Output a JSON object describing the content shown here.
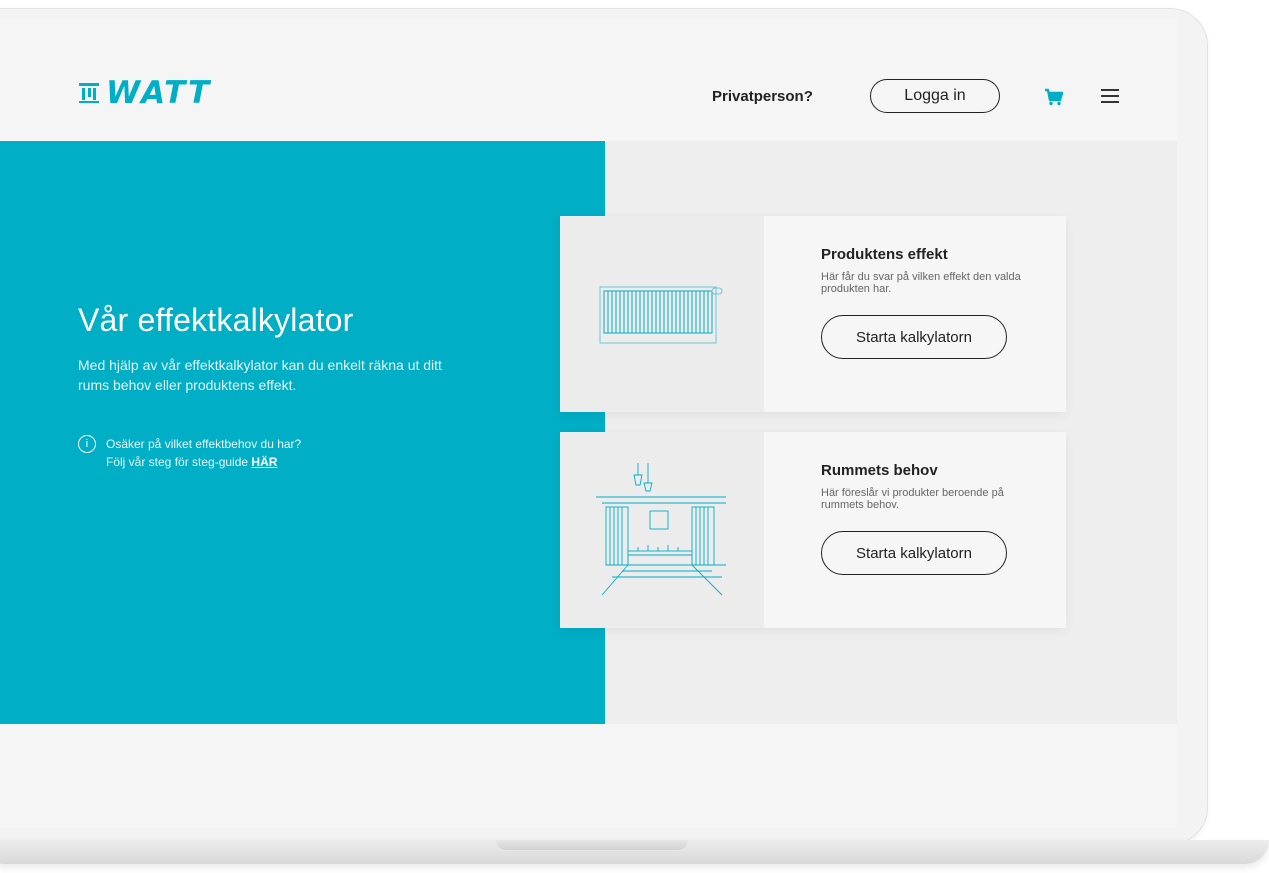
{
  "header": {
    "logo_text": "WATT",
    "privatperson": "Privatperson?",
    "login_label": "Logga in"
  },
  "hero": {
    "title": "Vår effektkalkylator",
    "description": "Med hjälp av vår effektkalkylator kan du enkelt räkna ut ditt rums behov eller produktens effekt.",
    "info_line1": "Osäker på vilket effektbehov du har?",
    "info_line2": "Följ vår steg för steg-guide ",
    "info_link": "HÄR"
  },
  "cards": [
    {
      "title": "Produktens effekt",
      "description": "Här får du svar på vilken effekt den valda produkten har.",
      "button": "Starta kalkylatorn"
    },
    {
      "title": "Rummets behov",
      "description": "Här föreslår vi produkter beroende på rummets behov.",
      "button": "Starta kalkylatorn"
    }
  ],
  "colors": {
    "accent": "#00aec6",
    "hero_grey": "#eeeeee",
    "text_dark": "#222222"
  },
  "icons": {
    "cart": "cart-icon",
    "menu": "hamburger-menu-icon",
    "info": "info-icon"
  }
}
